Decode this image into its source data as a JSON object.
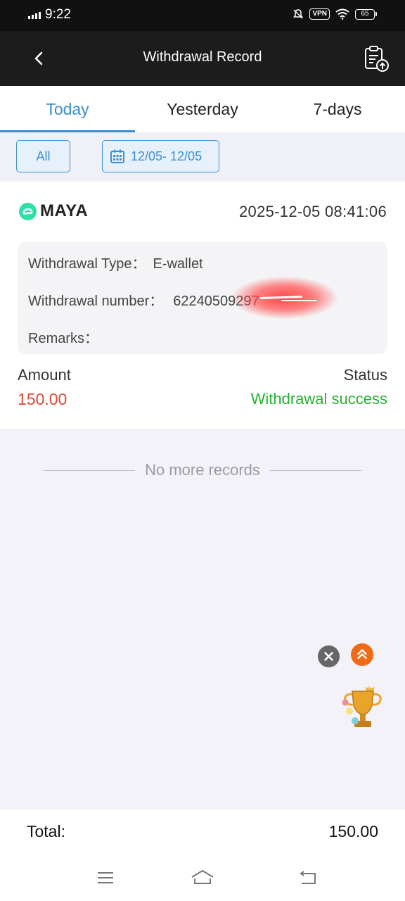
{
  "status_bar": {
    "time": "9:22",
    "vpn": "VPN",
    "battery": "65"
  },
  "header": {
    "title": "Withdrawal Record"
  },
  "tabs": [
    {
      "label": "Today",
      "active": true
    },
    {
      "label": "Yesterday",
      "active": false
    },
    {
      "label": "7-days",
      "active": false
    }
  ],
  "filter": {
    "all_label": "All",
    "date_range": "12/05- 12/05"
  },
  "record": {
    "brand": "MAYA",
    "datetime": "2025-12-05 08:41:06",
    "type_label": "Withdrawal Type：",
    "type_value": "E-wallet",
    "number_label": "Withdrawal number：",
    "number_value": "62240509297",
    "remarks_label": "Remarks：",
    "remarks_value": "",
    "amount_label": "Amount",
    "amount_value": "150.00",
    "status_label": "Status",
    "status_value": "Withdrawal success"
  },
  "no_more": "No more records",
  "footer": {
    "total_label": "Total:",
    "total_value": "150.00"
  },
  "colors": {
    "accent": "#3a8ed3",
    "amount": "#d9482f",
    "success": "#25b12f",
    "header_bg": "#1c1c1c"
  }
}
